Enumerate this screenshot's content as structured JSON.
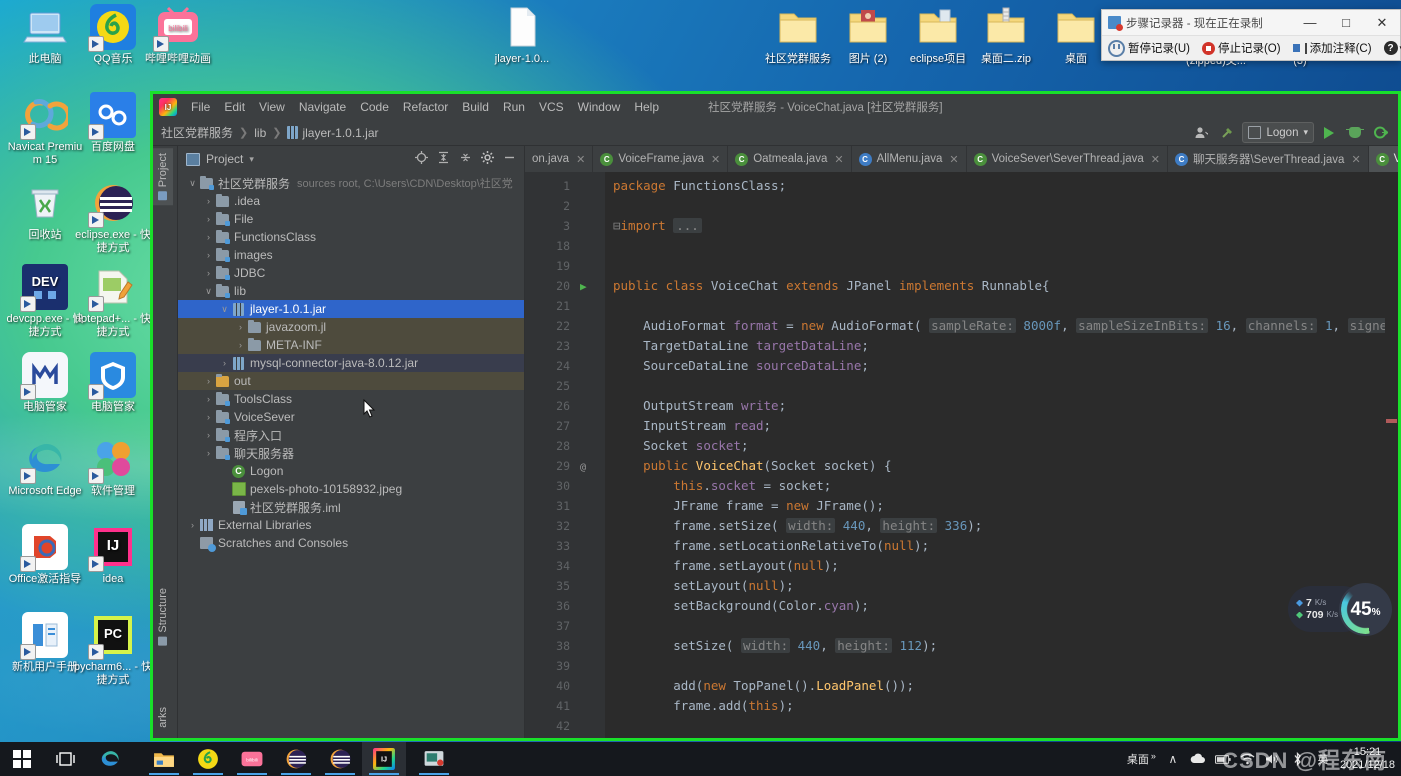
{
  "desktop": {
    "icons_left": [
      {
        "label": "此电脑",
        "icon": "computer-icon"
      },
      {
        "label": "QQ音乐",
        "icon": "qq-music-icon"
      },
      {
        "label": "哔哩哔哩动画",
        "icon": "bilibili-icon"
      },
      {
        "label": "Navicat Premium 15",
        "icon": "navicat-icon"
      },
      {
        "label": "百度网盘",
        "icon": "baidu-netdisk-icon"
      },
      {
        "label": "回收站",
        "icon": "recycle-bin-icon"
      },
      {
        "label": "eclipse.exe - 快捷方式",
        "icon": "eclipse-icon"
      },
      {
        "label": "devcpp.exe - 快捷方式",
        "icon": "devcpp-icon"
      },
      {
        "label": "notepad+... - 快捷方式",
        "icon": "notepadpp-icon"
      },
      {
        "label": "电脑管家",
        "icon": "pc-manager-icon"
      },
      {
        "label": "电脑管家",
        "icon": "tencent-pc-manager-icon"
      },
      {
        "label": "Microsoft Edge",
        "icon": "edge-icon"
      },
      {
        "label": "软件管理",
        "icon": "software-manager-icon"
      },
      {
        "label": "Office激活指导",
        "icon": "office-activate-icon"
      },
      {
        "label": "idea",
        "icon": "intellij-idea-icon"
      },
      {
        "label": "新机用户手册",
        "icon": "user-manual-icon"
      },
      {
        "label": "pycharm6... - 快捷方式",
        "icon": "pycharm-icon"
      }
    ],
    "icons_top": [
      {
        "label": "jlayer-1.0...",
        "icon": "file-icon"
      },
      {
        "label": "社区党群服务",
        "icon": "folder-icon"
      },
      {
        "label": "图片 (2)",
        "icon": "picture-folder-icon"
      },
      {
        "label": "eclipse项目",
        "icon": "folder-icon"
      },
      {
        "label": "桌面二.zip",
        "icon": "zip-folder-icon"
      },
      {
        "label": "桌面",
        "icon": "folder-icon"
      }
    ],
    "icons_second_row": [
      {
        "label": "(zipped)文...",
        "icon": "zip-folder-icon"
      },
      {
        "label": "(3)",
        "icon": "folder-icon"
      }
    ]
  },
  "recorder": {
    "title": "步骤记录器 - 现在正在录制",
    "minimize": "—",
    "maximize": "□",
    "close": "✕",
    "buttons": [
      {
        "label": "暂停记录(U)",
        "icon": "pause-record-icon"
      },
      {
        "label": "停止记录(O)",
        "icon": "stop-record-icon"
      },
      {
        "label": "添加注释(C)",
        "icon": "add-comment-icon"
      }
    ],
    "help_label": "?",
    "help_caret": "▾"
  },
  "ide": {
    "window_title": "社区党群服务 - VoiceChat.java [社区党群服务]",
    "menu": [
      "File",
      "Edit",
      "View",
      "Navigate",
      "Code",
      "Refactor",
      "Build",
      "Run",
      "VCS",
      "Window",
      "Help"
    ],
    "breadcrumb": [
      "社区党群服务",
      "lib",
      "jlayer-1.0.1.jar"
    ],
    "toolbar_right": {
      "run_config": "Logon",
      "profile_icon": "user-profile-icon",
      "build_icon": "build-hammer-icon",
      "run_icon": "run-play-icon",
      "debug_icon": "debug-bug-icon",
      "coverage_icon": "run-with-coverage-icon"
    },
    "left_strip": [
      "Project",
      "Structure",
      "arks"
    ],
    "project_panel": {
      "title": "Project",
      "dropdown_caret": "▾",
      "actions": [
        "locate-icon",
        "expand-all-icon",
        "collapse-all-icon",
        "settings-gear-icon",
        "hide-panel-icon"
      ],
      "tree": [
        {
          "label": "社区党群服务",
          "sub": "sources root, C:\\Users\\CDN\\Desktop\\社区党",
          "arrow": "∨",
          "indent": 0,
          "icon": "module-folder-icon",
          "state": "normal"
        },
        {
          "label": ".idea",
          "sub": "",
          "arrow": "›",
          "indent": 1,
          "icon": "folder-icon",
          "state": "normal"
        },
        {
          "label": "File",
          "sub": "",
          "arrow": "›",
          "indent": 1,
          "icon": "source-folder-icon",
          "state": "normal"
        },
        {
          "label": "FunctionsClass",
          "sub": "",
          "arrow": "›",
          "indent": 1,
          "icon": "source-folder-icon",
          "state": "normal"
        },
        {
          "label": "images",
          "sub": "",
          "arrow": "›",
          "indent": 1,
          "icon": "source-folder-icon",
          "state": "normal"
        },
        {
          "label": "JDBC",
          "sub": "",
          "arrow": "›",
          "indent": 1,
          "icon": "source-folder-icon",
          "state": "normal"
        },
        {
          "label": "lib",
          "sub": "",
          "arrow": "∨",
          "indent": 1,
          "icon": "source-folder-icon",
          "state": "normal"
        },
        {
          "label": "jlayer-1.0.1.jar",
          "sub": "",
          "arrow": "∨",
          "indent": 2,
          "icon": "jar-icon",
          "state": "selected"
        },
        {
          "label": "javazoom.jl",
          "sub": "",
          "arrow": "›",
          "indent": 3,
          "icon": "folder-icon",
          "state": "highlight"
        },
        {
          "label": "META-INF",
          "sub": "",
          "arrow": "›",
          "indent": 3,
          "icon": "folder-icon",
          "state": "highlight"
        },
        {
          "label": "mysql-connector-java-8.0.12.jar",
          "sub": "",
          "arrow": "›",
          "indent": 2,
          "icon": "jar-icon",
          "state": "highlight2"
        },
        {
          "label": "out",
          "sub": "",
          "arrow": "›",
          "indent": 1,
          "icon": "excluded-folder-icon",
          "state": "highlight"
        },
        {
          "label": "ToolsClass",
          "sub": "",
          "arrow": "›",
          "indent": 1,
          "icon": "source-folder-icon",
          "state": "normal"
        },
        {
          "label": "VoiceSever",
          "sub": "",
          "arrow": "›",
          "indent": 1,
          "icon": "source-folder-icon",
          "state": "normal"
        },
        {
          "label": "程序入口",
          "sub": "",
          "arrow": "›",
          "indent": 1,
          "icon": "source-folder-icon",
          "state": "normal"
        },
        {
          "label": "聊天服务器",
          "sub": "",
          "arrow": "›",
          "indent": 1,
          "icon": "source-folder-icon",
          "state": "normal"
        },
        {
          "label": "Logon",
          "sub": "",
          "arrow": "",
          "indent": 2,
          "icon": "java-class-icon",
          "state": "normal"
        },
        {
          "label": "pexels-photo-10158932.jpeg",
          "sub": "",
          "arrow": "",
          "indent": 2,
          "icon": "image-file-icon",
          "state": "normal"
        },
        {
          "label": "社区党群服务.iml",
          "sub": "",
          "arrow": "",
          "indent": 2,
          "icon": "iml-file-icon",
          "state": "normal"
        },
        {
          "label": "External Libraries",
          "sub": "",
          "arrow": "›",
          "indent": 0,
          "icon": "library-icon",
          "state": "normal"
        },
        {
          "label": "Scratches and Consoles",
          "sub": "",
          "arrow": "",
          "indent": 0,
          "icon": "scratches-icon",
          "state": "normal"
        }
      ]
    },
    "editor_tabs": [
      {
        "label": "on.java",
        "icon": "",
        "active": false,
        "clipped": true
      },
      {
        "label": "VoiceFrame.java",
        "icon": "java-class-icon-green",
        "active": false
      },
      {
        "label": "Oatmeala.java",
        "icon": "java-class-icon-green",
        "active": false
      },
      {
        "label": "AllMenu.java",
        "icon": "java-class-icon-blue",
        "active": false
      },
      {
        "label": "VoiceSever\\SeverThread.java",
        "icon": "java-class-icon-green",
        "active": false
      },
      {
        "label": "聊天服务器\\SeverThread.java",
        "icon": "java-class-icon-blue",
        "active": false
      },
      {
        "label": "Voice",
        "icon": "java-class-icon-green",
        "active": true,
        "clipped": true
      }
    ],
    "tab_close": "✕",
    "code_lines": [
      {
        "num": "1",
        "mark": "",
        "html": "<span class=\"kw\">package</span> FunctionsClass;"
      },
      {
        "num": "2",
        "mark": "",
        "html": ""
      },
      {
        "num": "3",
        "mark": "",
        "html": "<span class=\"foldmark\">⊟</span><span class=\"kw\">import</span> <span class=\"collapsed\">...</span>"
      },
      {
        "num": "18",
        "mark": "",
        "html": ""
      },
      {
        "num": "19",
        "mark": "",
        "html": ""
      },
      {
        "num": "20",
        "mark": "play",
        "html": "<span class=\"kw\">public class</span> <span class=\"typ\">VoiceChat</span> <span class=\"kw\">extends</span> JPanel <span class=\"kw\">implements</span> Runnable{"
      },
      {
        "num": "21",
        "mark": "",
        "html": ""
      },
      {
        "num": "22",
        "mark": "",
        "html": "    AudioFormat <span class=\"fld\">format</span> = <span class=\"kw\">new</span> AudioFormat( <span class=\"hint\">sampleRate:</span> <span class=\"num\">8000f</span>, <span class=\"hint\">sampleSizeInBits:</span> <span class=\"num\">16</span>, <span class=\"hint\">channels:</span> <span class=\"num\">1</span>, <span class=\"hint\">signed:</span> <span class=\"kw\">true</span>, <span class=\"hint\">bigEndian:</span>"
      },
      {
        "num": "23",
        "mark": "",
        "html": "    TargetDataLine <span class=\"fld\">targetDataLine</span>;"
      },
      {
        "num": "24",
        "mark": "",
        "html": "    SourceDataLine <span class=\"fld\">sourceDataLine</span>;"
      },
      {
        "num": "25",
        "mark": "",
        "html": ""
      },
      {
        "num": "26",
        "mark": "",
        "html": "    OutputStream <span class=\"fld\">write</span>;"
      },
      {
        "num": "27",
        "mark": "",
        "html": "    InputStream <span class=\"fld\">read</span>;"
      },
      {
        "num": "28",
        "mark": "",
        "html": "    Socket <span class=\"fld\">socket</span>;"
      },
      {
        "num": "29",
        "mark": "at",
        "html": "    <span class=\"kw\">public</span> <span class=\"fn\">VoiceChat</span>(Socket socket) {"
      },
      {
        "num": "30",
        "mark": "",
        "html": "        <span class=\"kw\">this</span>.<span class=\"fld\">socket</span> = socket;"
      },
      {
        "num": "31",
        "mark": "",
        "html": "        JFrame frame = <span class=\"kw\">new</span> JFrame();"
      },
      {
        "num": "32",
        "mark": "",
        "html": "        frame.setSize( <span class=\"hint\">width:</span> <span class=\"num\">440</span>, <span class=\"hint\">height:</span> <span class=\"num\">336</span>);"
      },
      {
        "num": "33",
        "mark": "",
        "html": "        frame.setLocationRelativeTo(<span class=\"kw\">null</span>);"
      },
      {
        "num": "34",
        "mark": "",
        "html": "        frame.setLayout(<span class=\"kw\">null</span>);"
      },
      {
        "num": "35",
        "mark": "",
        "html": "        setLayout(<span class=\"kw\">null</span>);"
      },
      {
        "num": "36",
        "mark": "",
        "html": "        setBackground(Color.<span class=\"fld\">cyan</span>);"
      },
      {
        "num": "37",
        "mark": "",
        "html": ""
      },
      {
        "num": "38",
        "mark": "",
        "html": "        setSize( <span class=\"hint\">width:</span> <span class=\"num\">440</span>, <span class=\"hint\">height:</span> <span class=\"num\">112</span>);"
      },
      {
        "num": "39",
        "mark": "",
        "html": ""
      },
      {
        "num": "40",
        "mark": "",
        "html": "        add(<span class=\"kw\">new</span> TopPanel().<span class=\"fn\">LoadPanel</span>());"
      },
      {
        "num": "41",
        "mark": "",
        "html": "        frame.add(<span class=\"kw\">this</span>);"
      },
      {
        "num": "42",
        "mark": "",
        "html": ""
      }
    ]
  },
  "net_widget": {
    "upload": "7",
    "upload_unit": "K/s",
    "download": "709",
    "download_unit": "K/s",
    "percent": "45",
    "percent_unit": "%"
  },
  "taskbar": {
    "items": [
      {
        "name": "start-button",
        "icon": "windows-logo-icon"
      },
      {
        "name": "task-view-button",
        "icon": "task-view-icon"
      },
      {
        "name": "edge-button",
        "icon": "edge-icon"
      },
      {
        "name": "file-explorer-button",
        "icon": "folder-icon"
      },
      {
        "name": "qq-music-button",
        "icon": "qq-music-icon"
      },
      {
        "name": "bilibili-button",
        "icon": "bilibili-icon"
      },
      {
        "name": "eclipse-button-1",
        "icon": "eclipse-icon"
      },
      {
        "name": "eclipse-button-2",
        "icon": "eclipse-icon"
      },
      {
        "name": "intellij-idea-button",
        "icon": "intellij-idea-icon"
      },
      {
        "name": "steps-recorder-button",
        "icon": "steps-recorder-icon"
      }
    ],
    "tray": {
      "desktop_label": "桌面",
      "overflow": "»",
      "chevron": "∧",
      "icons": [
        "cloud-icon",
        "battery-icon",
        "wifi-icon",
        "volume-icon",
        "bluetooth-icon"
      ],
      "ime": "英",
      "time": "15:21",
      "date": "2021/12/18"
    },
    "watermark": "CSDN @程东南"
  }
}
